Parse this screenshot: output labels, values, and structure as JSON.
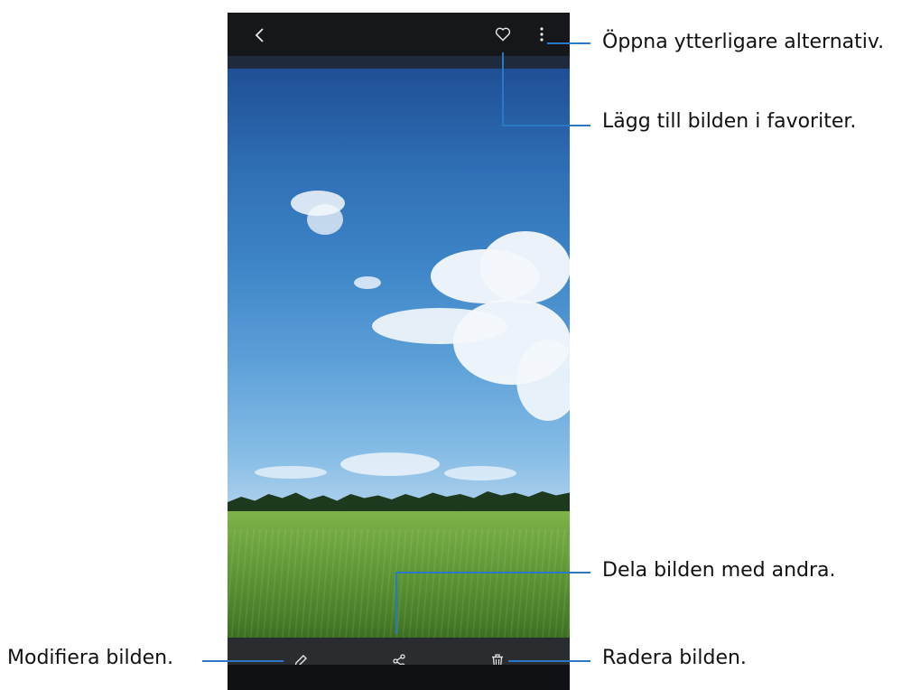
{
  "viewer": {
    "icons": {
      "back": "chevron-left-icon",
      "favorite": "heart-icon",
      "more": "more-vertical-icon",
      "edit": "pencil-icon",
      "share": "share-icon",
      "delete": "trash-icon"
    }
  },
  "callouts": {
    "more_options": "Öppna ytterligare alternativ.",
    "favorite": "Lägg till bilden i favoriter.",
    "share": "Dela bilden med andra.",
    "edit": "Modifiera bilden.",
    "delete": "Radera bilden."
  },
  "colors": {
    "callout_line": "#2b78c4",
    "bar": "#2a2d30",
    "icon": "#e8e8e8"
  }
}
